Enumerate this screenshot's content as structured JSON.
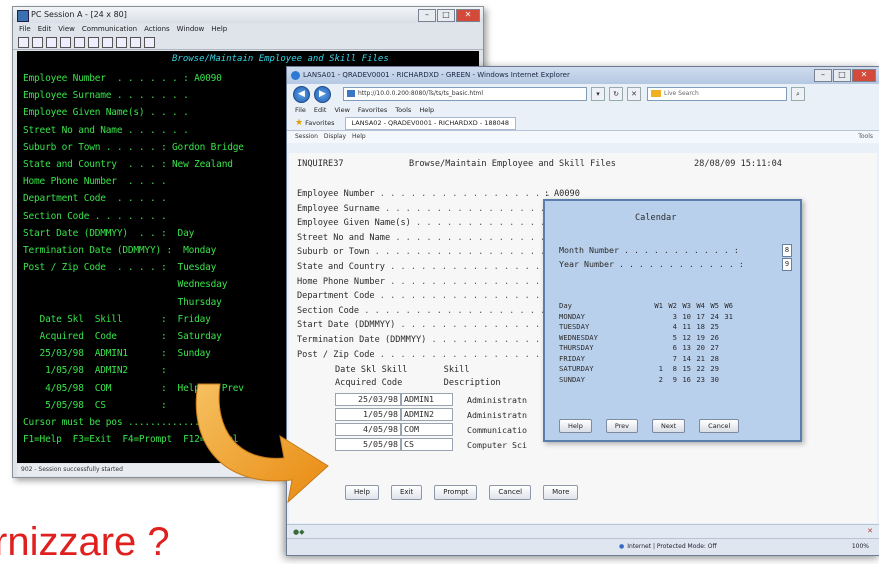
{
  "terminal": {
    "title": "PC Session A - [24 x 80]",
    "menu": [
      "File",
      "Edit",
      "View",
      "Communication",
      "Actions",
      "Window",
      "Help"
    ],
    "heading": "Browse/Maintain Employee and Skill Files",
    "lines": [
      "Employee Number  . . . . . . : A0090",
      "Employee Surname . . . . . . .",
      "Employee Given Name(s) . . . .",
      "Street No and Name . . . . . .",
      "Suburb or Town . . . . . : Gordon Bridge",
      "State and Country  . . . : New Zealand",
      "Home Phone Number  . . . .",
      "Department Code  . . . . .",
      "Section Code . . . . . . .",
      "Start Date (DDMMYY)  . . :  Day",
      "Termination Date (DDMMYY) :  Monday",
      "Post / Zip Code  . . . . :  Tuesday",
      "                            Wednesday",
      "                            Thursday",
      "   Date Skl  Skill       :  Friday",
      "   Acquired  Code        :  Saturday",
      "   25/03/98  ADMIN1      :  Sunday",
      "    1/05/98  ADMIN2      :",
      "    4/05/98  COM         :  Help    Prev",
      "    5/05/98  CS          :",
      "Cursor must be pos ...............",
      "F1=Help  F3=Exit  F4=Prompt  F12=Cancel"
    ],
    "status": "902 - Session successfully started"
  },
  "browser": {
    "title": "LANSA01 - QRADEV0001 - RICHARDXD - GREEN - Windows Internet Explorer",
    "address": "http://10.0.0.200:8080/Ts/ts/ts_basic.html",
    "search_placeholder": "Live Search",
    "menu": [
      "File",
      "Edit",
      "View",
      "Favorites",
      "Tools",
      "Help"
    ],
    "favorites_label": "Favorites",
    "tab_label": "LANSA02 - QRADEV0001 - RICHARDXD - 188048",
    "command_items": [
      "Session",
      "Display",
      "Help"
    ],
    "command_right": "Tools",
    "zone": "Internet | Protected Mode: Off",
    "zoom": "100%"
  },
  "screen": {
    "id": "INQUIRE37",
    "title": "Browse/Maintain Employee and Skill Files",
    "datetime": "28/08/09 15:11:04",
    "fields": [
      {
        "label": "Employee Number",
        "value": "A0090"
      },
      {
        "label": "Employee Surname",
        "value": ""
      },
      {
        "label": "Employee Given Name(s)",
        "value": ""
      },
      {
        "label": "Street No and Name",
        "value": ""
      },
      {
        "label": "Suburb or Town",
        "value": ""
      },
      {
        "label": "State and Country",
        "value": ""
      },
      {
        "label": "Home Phone Number",
        "value": ""
      },
      {
        "label": "Department Code",
        "value": ""
      },
      {
        "label": "Section Code",
        "value": ""
      },
      {
        "label": "Start Date (DDMMYY)",
        "value": ""
      },
      {
        "label": "Termination Date (DDMMYY)",
        "value": ""
      },
      {
        "label": "Post / Zip Code",
        "value": ""
      }
    ],
    "grid_header_1": "Date Skl Skill       Skill",
    "grid_header_2": "Acquired Code        Description",
    "skills": [
      {
        "date": "25/03/98",
        "code": "ADMIN1",
        "desc": "Administratn"
      },
      {
        "date": "1/05/98",
        "code": "ADMIN2",
        "desc": "Administratn"
      },
      {
        "date": "4/05/98",
        "code": "COM",
        "desc": "Communication"
      },
      {
        "date": "5/05/98",
        "code": "CS",
        "desc": "Computer Sci"
      }
    ],
    "buttons": [
      "Help",
      "Exit",
      "Prompt",
      "Cancel",
      "More"
    ]
  },
  "calendar": {
    "title": "Calendar",
    "month_label": "Month Number",
    "year_label": "Year Number",
    "month_value": "8",
    "year_value": "9",
    "header": [
      "Day",
      "W1",
      "W2",
      "W3",
      "W4",
      "W5",
      "W6"
    ],
    "rows": [
      {
        "day": "MONDAY",
        "w": [
          "",
          "3",
          "10",
          "17",
          "24",
          "31"
        ]
      },
      {
        "day": "TUESDAY",
        "w": [
          "",
          "4",
          "11",
          "18",
          "25",
          ""
        ]
      },
      {
        "day": "WEDNESDAY",
        "w": [
          "",
          "5",
          "12",
          "19",
          "26",
          ""
        ]
      },
      {
        "day": "THURSDAY",
        "w": [
          "",
          "6",
          "13",
          "20",
          "27",
          ""
        ]
      },
      {
        "day": "FRIDAY",
        "w": [
          "",
          "7",
          "14",
          "21",
          "28",
          ""
        ]
      },
      {
        "day": "SATURDAY",
        "w": [
          "1",
          "8",
          "15",
          "22",
          "29",
          ""
        ]
      },
      {
        "day": "SUNDAY",
        "w": [
          "2",
          "9",
          "16",
          "23",
          "30",
          ""
        ]
      }
    ],
    "buttons": [
      "Help",
      "Prev",
      "Next",
      "Cancel"
    ]
  },
  "caption": "rnizzare ?",
  "colors": {
    "terminal_green": "#38e24a",
    "arrow_orange": "#f0a030",
    "caption_red": "#e0201e",
    "calendar_bg": "#b9d0ec"
  }
}
